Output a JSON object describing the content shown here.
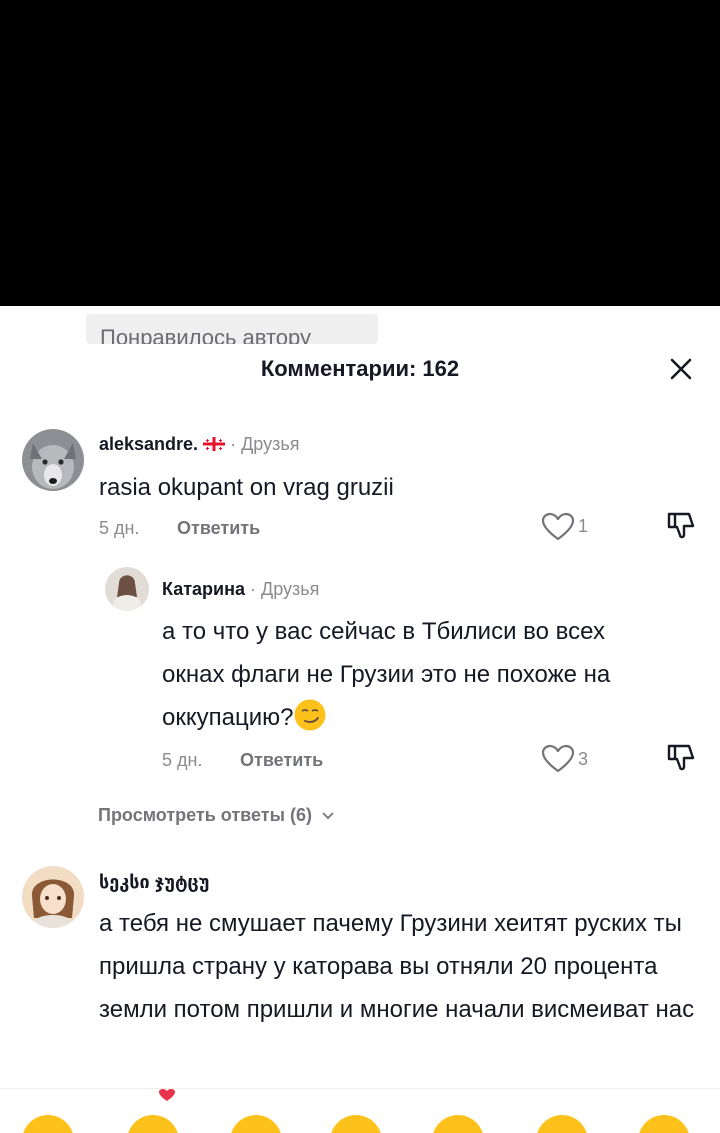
{
  "video": {
    "background": "#000000"
  },
  "sheet": {
    "liked_by_author": "Понравилось автору",
    "title": "Комментарии: 162"
  },
  "comments": [
    {
      "username": "aleksandre.",
      "relation": "Друзья",
      "text": "rasia okupant on vrag gruzii",
      "age": "5 дн.",
      "reply_label": "Ответить",
      "likes": "1",
      "flag": "georgia-flag"
    },
    {
      "username": "Катарина",
      "relation": "Друзья",
      "text": "а то что у вас сейчас в Тбилиси во всех окнах флаги не Грузии это не похоже на оккупацию?",
      "emoji": "smirk-emoji",
      "age": "5 дн.",
      "reply_label": "Ответить",
      "likes": "3"
    },
    {
      "username": "სეკსი ჯუტცუ",
      "text": "а тебя не смушает пачему Грузини хеитят руских ты пришла страну у каторава вы отняли 20 процента земли потом пришли и многие начали висмеиват нас"
    }
  ],
  "view_replies": "Просмотреть ответы (6)",
  "emoji_bar": [
    "grinning",
    "smiling-with-hearts",
    "smiling",
    "blushing",
    "relieved",
    "sweat-smile",
    "pensive"
  ],
  "colors": {
    "text": "#161823",
    "muted": "#8a8b91",
    "link": "#73747a"
  }
}
